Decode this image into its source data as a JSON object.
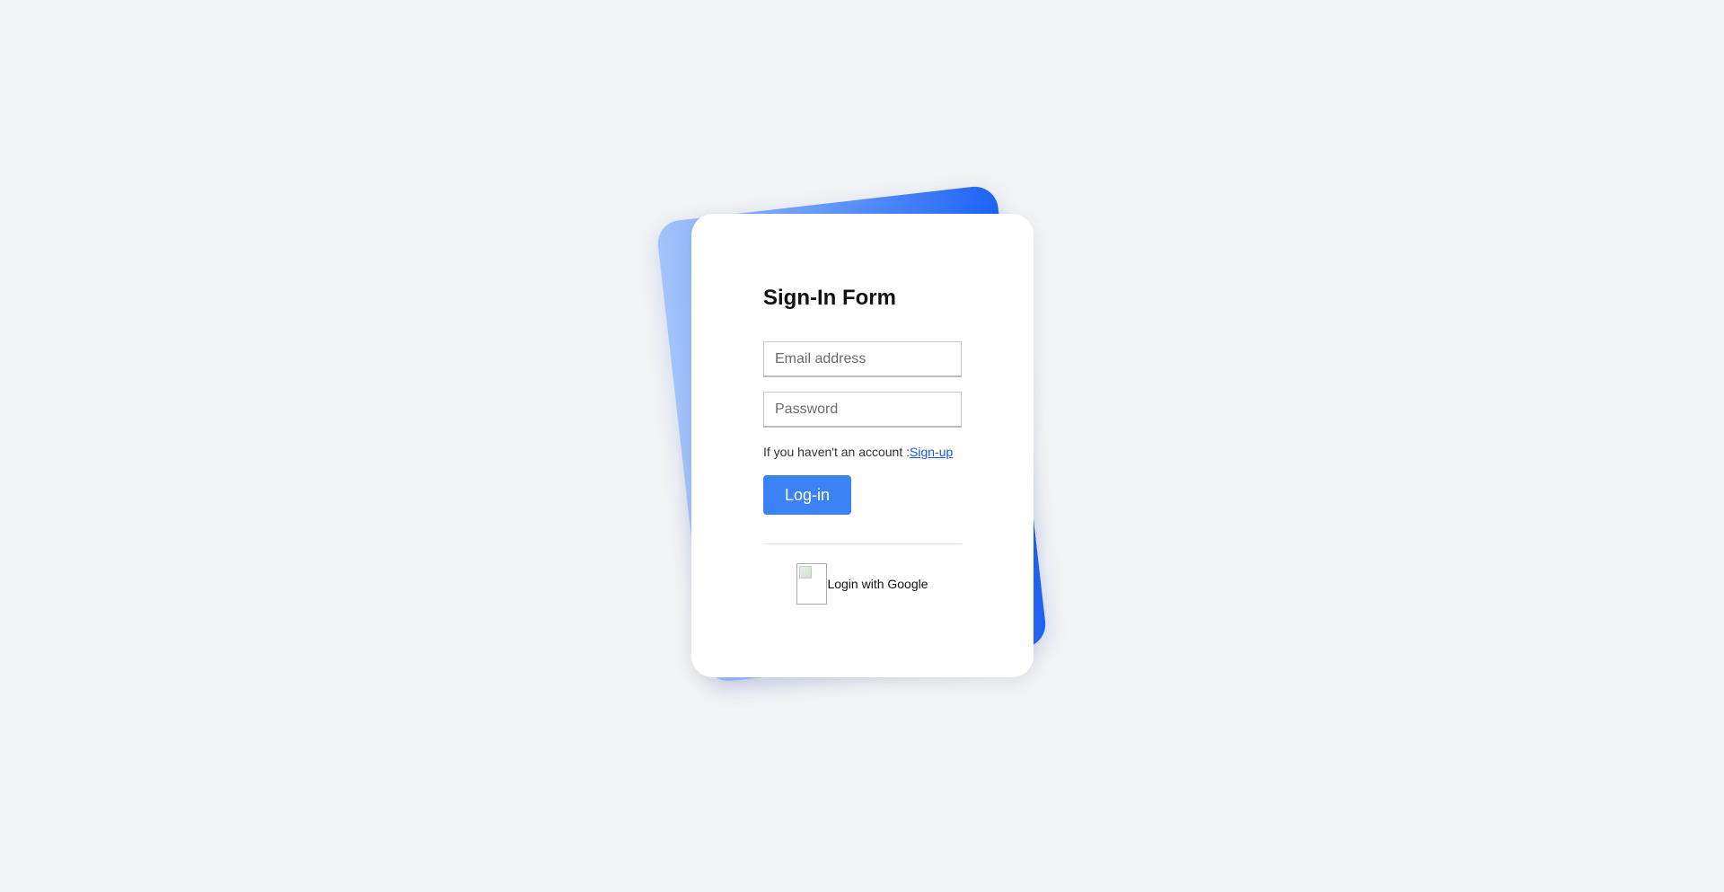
{
  "form": {
    "title": "Sign-In Form",
    "email_placeholder": "Email address",
    "email_value": "",
    "password_placeholder": "Password",
    "password_value": "",
    "signup_prompt": "If you haven't an account :",
    "signup_link": "Sign-up",
    "login_button": "Log-in",
    "google_login_label": "Login with Google"
  },
  "colors": {
    "page_background": "#f2f3f5",
    "accent": "#3b82f6",
    "link": "#1a56db",
    "back_card_gradient_start": "#a3c4fa",
    "back_card_gradient_end": "#1f63f5"
  },
  "icons": {
    "google": "broken-image-icon"
  }
}
